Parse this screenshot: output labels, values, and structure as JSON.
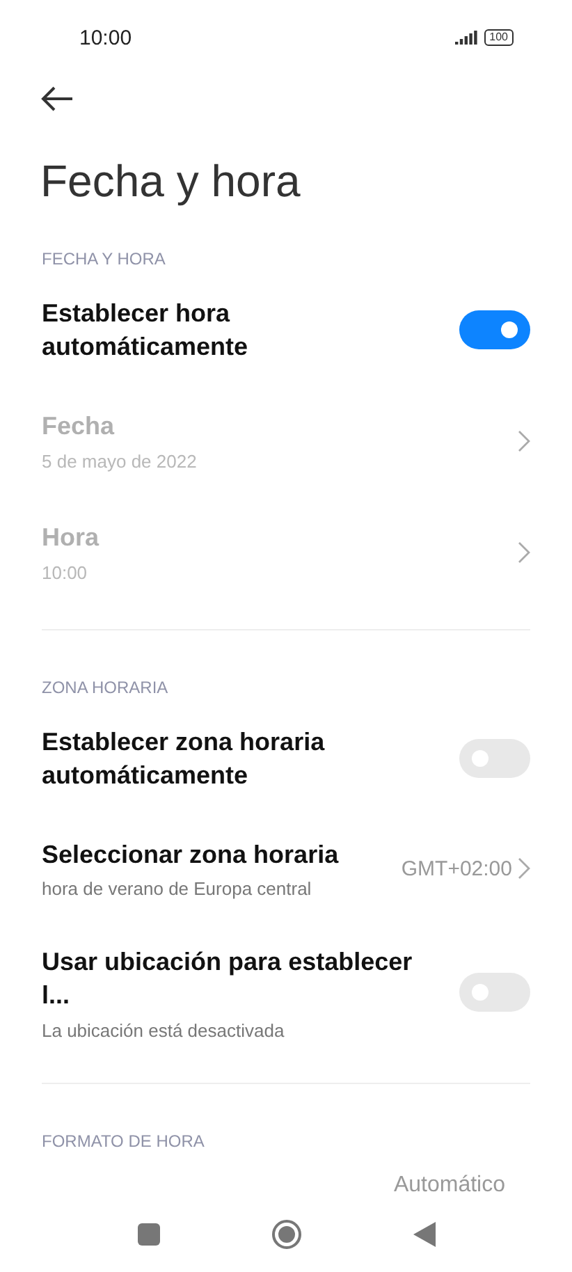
{
  "status_bar": {
    "time": "10:00",
    "battery": "100"
  },
  "title": "Fecha y hora",
  "sections": [
    {
      "header": "FECHA Y HORA",
      "items": [
        {
          "kind": "toggle",
          "label": "Establecer hora automáticamente",
          "on": true,
          "disabled": false
        },
        {
          "kind": "nav",
          "label": "Fecha",
          "subtitle": "5 de mayo de 2022",
          "disabled": true
        },
        {
          "kind": "nav",
          "label": "Hora",
          "subtitle": "10:00",
          "disabled": true
        }
      ]
    },
    {
      "header": "ZONA HORARIA",
      "items": [
        {
          "kind": "toggle",
          "label": "Establecer zona horaria automáticamente",
          "on": false,
          "disabled": false
        },
        {
          "kind": "nav",
          "label": "Seleccionar zona horaria",
          "subtitle": "hora de verano de Europa central",
          "value": "GMT+02:00",
          "disabled": false
        },
        {
          "kind": "toggle",
          "label": "Usar ubicación para establecer l...",
          "subtitle": "La ubicación está desactivada",
          "on": false,
          "disabled": false
        }
      ]
    },
    {
      "header": "FORMATO DE HORA",
      "items": [
        {
          "kind": "partial",
          "value": "Automático"
        }
      ]
    }
  ]
}
